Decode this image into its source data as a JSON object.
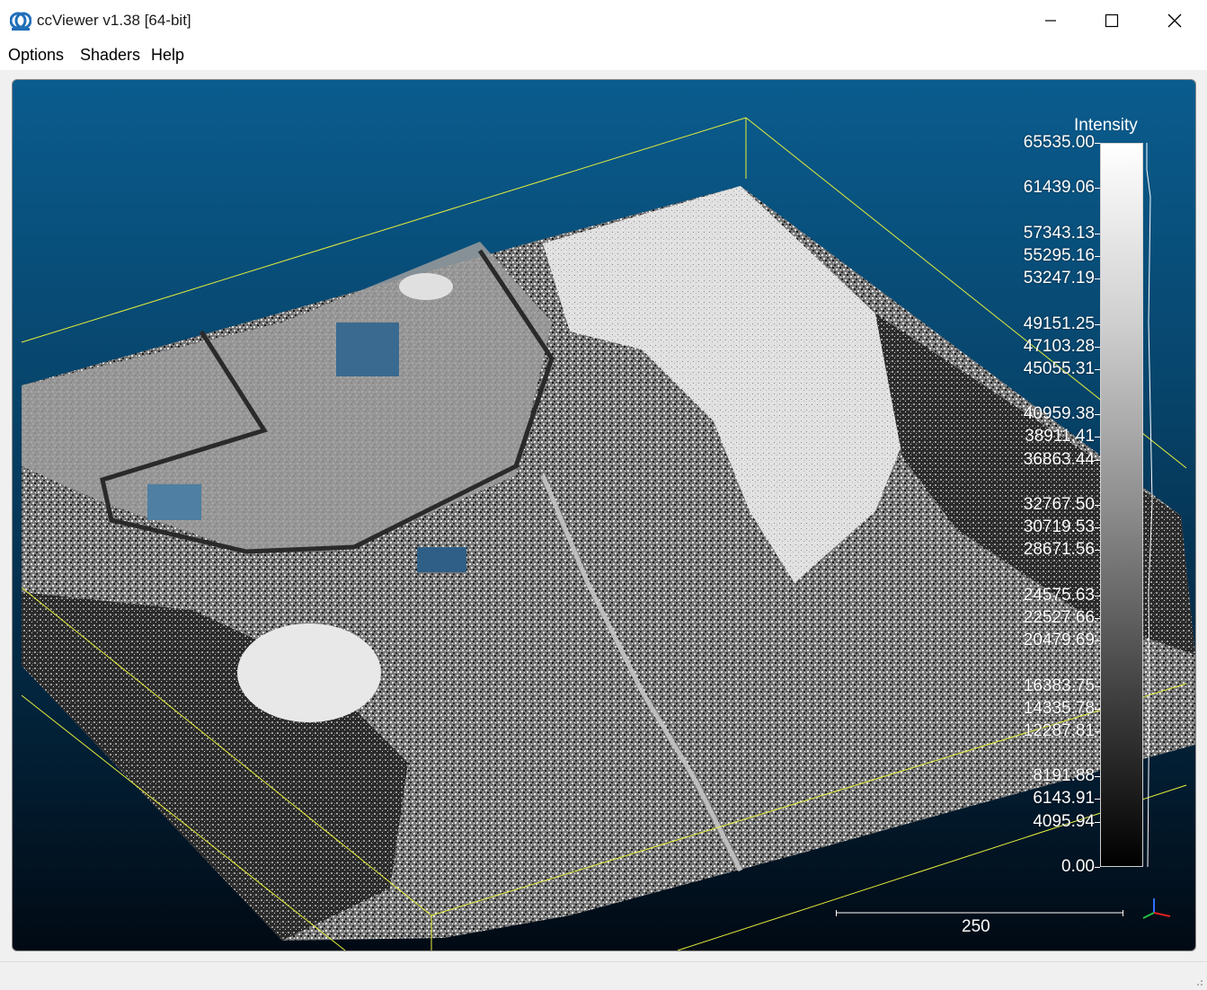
{
  "window": {
    "title": "ccViewer v1.38 [64-bit]",
    "icon": "ccviewer-app-icon",
    "controls": [
      "minimize-icon",
      "maximize-icon",
      "close-icon"
    ]
  },
  "menu": {
    "options": "Options",
    "shaders": "Shaders",
    "help": "Help"
  },
  "scalar_field": {
    "title": "Intensity",
    "ticks": [
      "65535.00",
      "61439.06",
      "57343.13",
      "55295.16",
      "53247.19",
      "49151.25",
      "47103.28",
      "45055.31",
      "40959.38",
      "38911.41",
      "36863.44",
      "32767.50",
      "30719.53",
      "28671.56",
      "24575.63",
      "22527.66",
      "20479.69",
      "16383.75",
      "14335.78",
      "12287.81",
      "8191.88",
      "6143.91",
      "4095.94",
      "0.00"
    ],
    "min": 0,
    "max": 65535
  },
  "scale": {
    "label": "250"
  },
  "colors": {
    "viewport_top": "#0a5c8e",
    "viewport_bottom": "#010a14",
    "bbox": "#e6f03a"
  }
}
